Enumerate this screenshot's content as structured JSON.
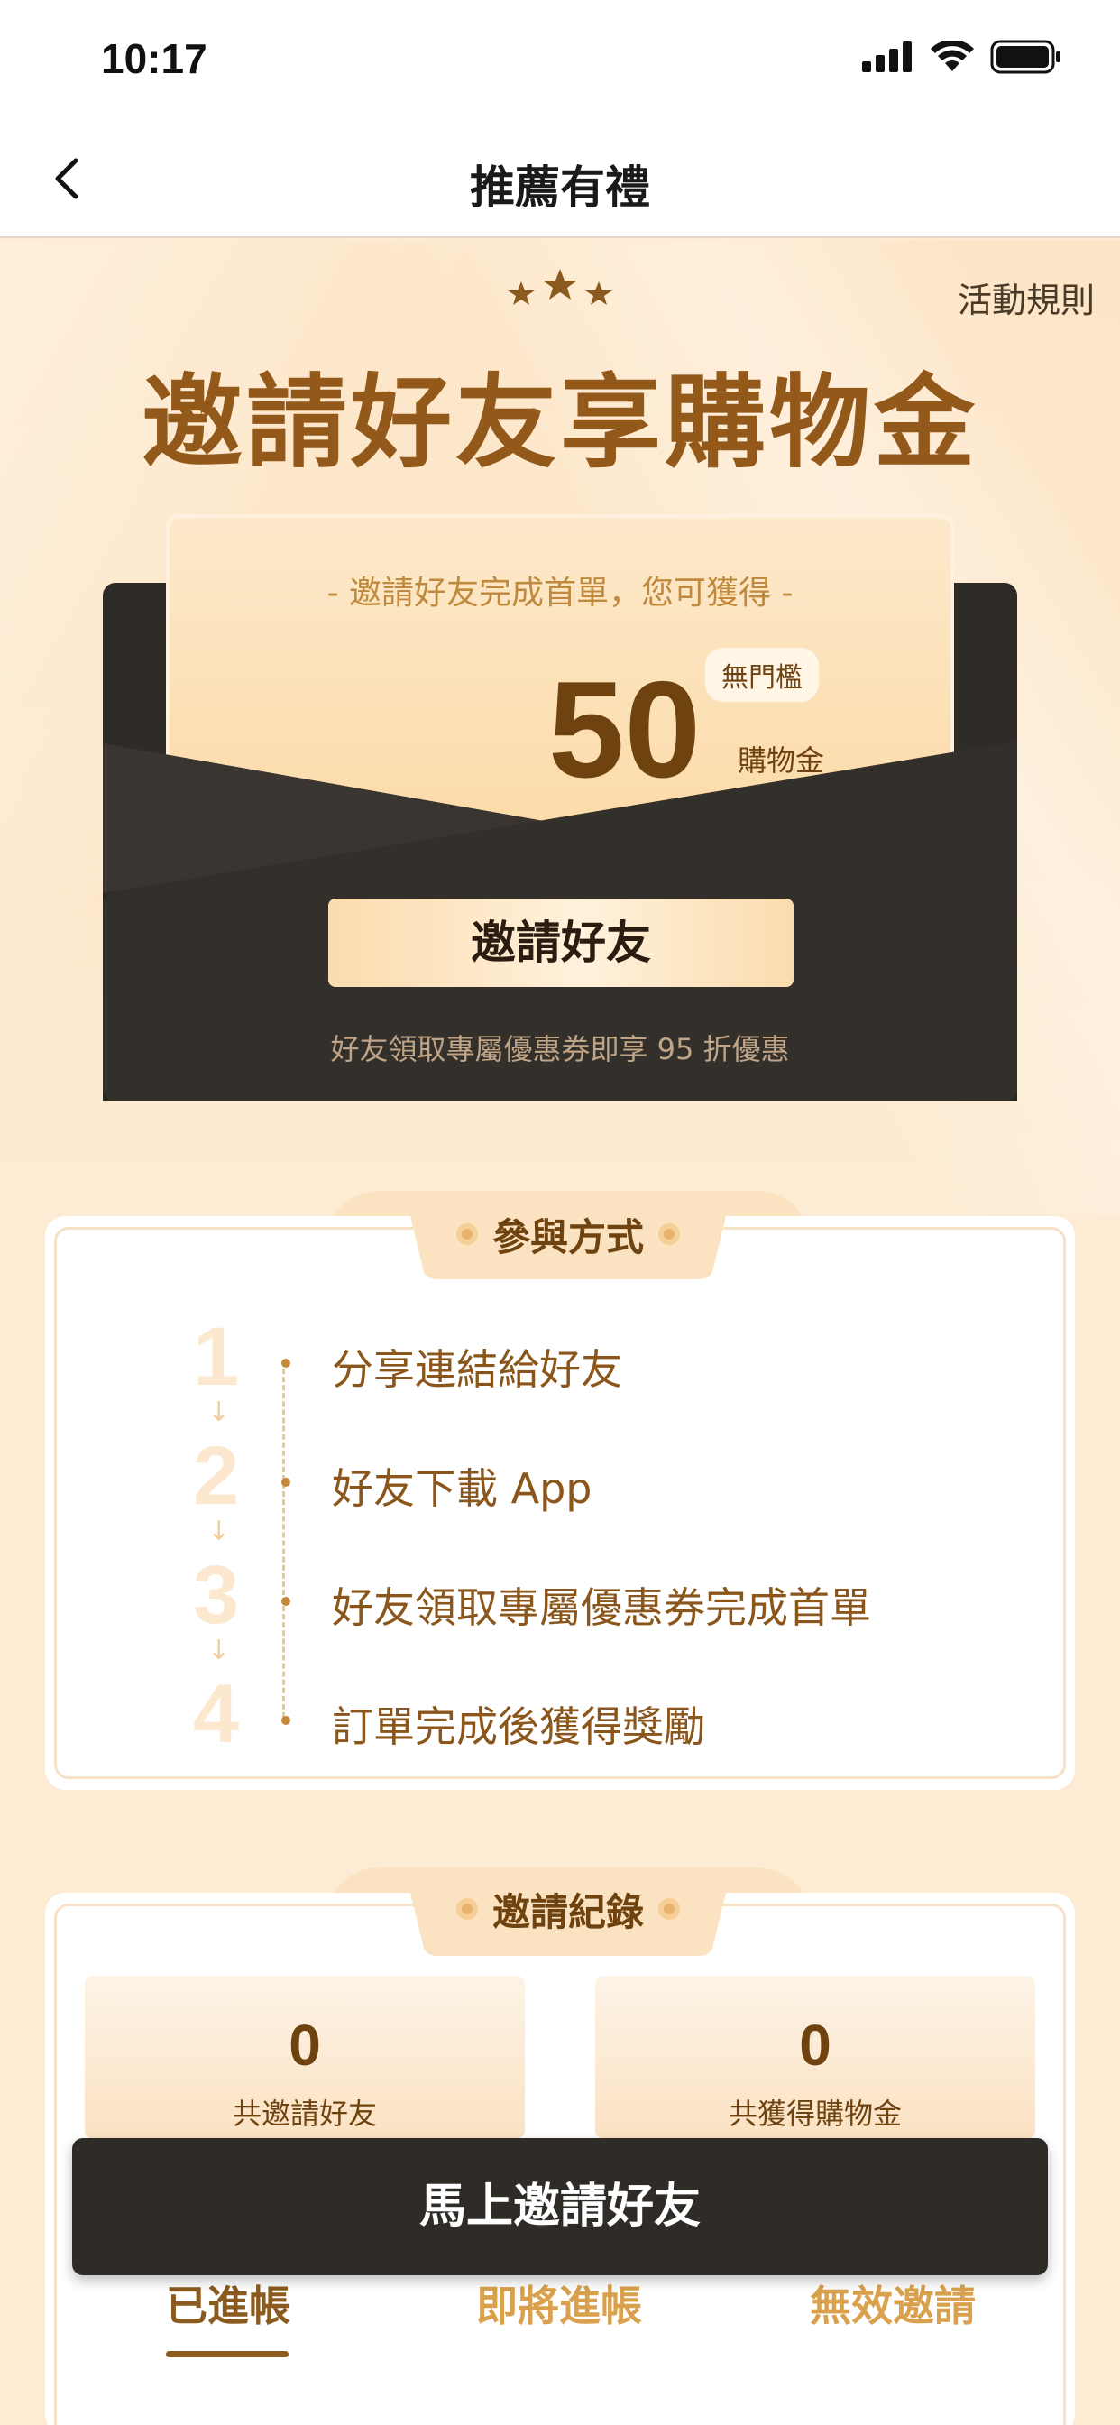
{
  "status_bar": {
    "time": "10:17"
  },
  "nav": {
    "title": "推薦有禮"
  },
  "hero": {
    "rules_link": "活動規則",
    "title": "邀請好友享購物金"
  },
  "reward_card": {
    "subtitle": "- 邀請好友完成首單，您可獲得 -",
    "amount": "50",
    "badge": "無門檻",
    "unit": "購物金",
    "button_label": "邀請好友",
    "note": "好友領取專屬優惠券即享 95 折優惠"
  },
  "participation": {
    "title": "參與方式",
    "steps": [
      {
        "num": "1",
        "text": "分享連結給好友"
      },
      {
        "num": "2",
        "text": "好友下載 App"
      },
      {
        "num": "3",
        "text": "好友領取專屬優惠券完成首單"
      },
      {
        "num": "4",
        "text": "訂單完成後獲得獎勵"
      }
    ]
  },
  "records": {
    "title": "邀請紀錄",
    "stats": [
      {
        "value": "0",
        "label": "共邀請好友"
      },
      {
        "value": "0",
        "label": "共獲得購物金"
      }
    ],
    "tabs": [
      "已進帳",
      "即將進帳",
      "無效邀請"
    ]
  },
  "cta": {
    "label": "馬上邀請好友"
  },
  "colors": {
    "brand_brown": "#93591a",
    "dark_envelope": "#2f2b27",
    "page_bg": "#fdebd3",
    "accent_gold": "#d9a14d"
  }
}
